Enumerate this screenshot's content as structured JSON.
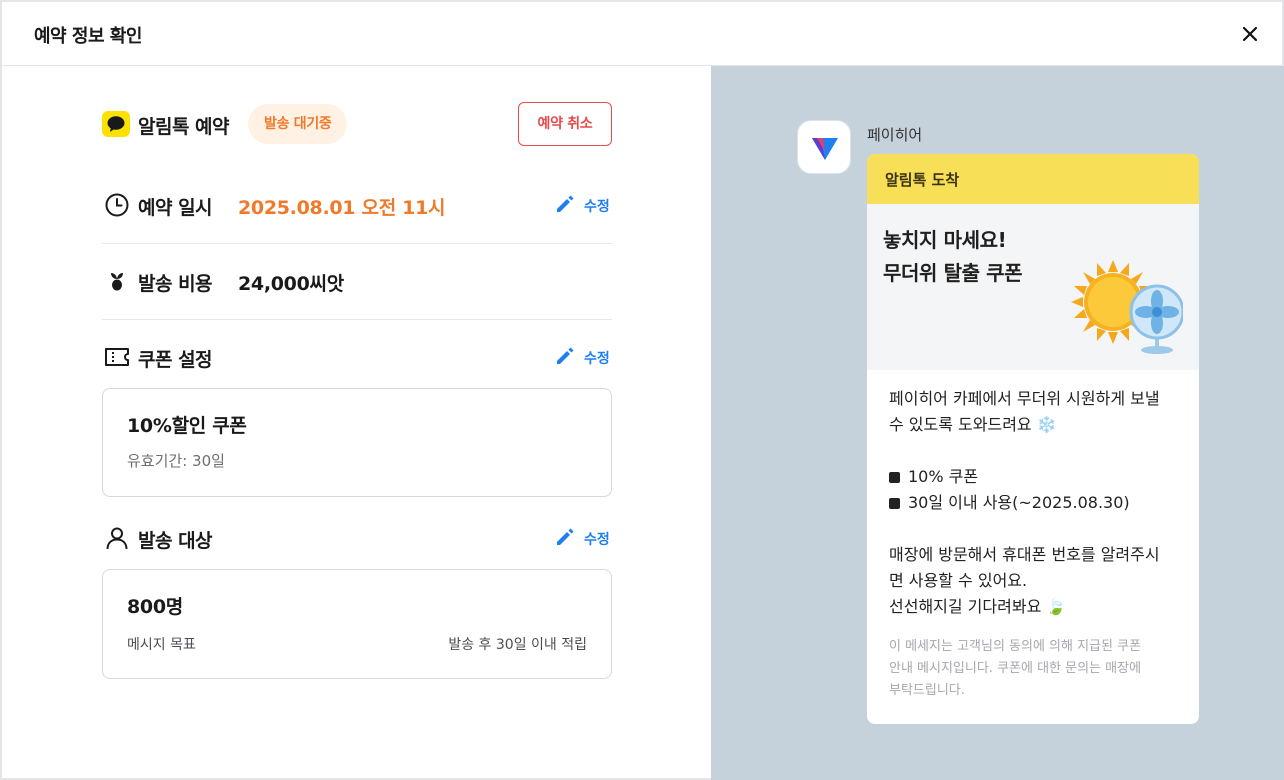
{
  "modal": {
    "title": "예약 정보 확인",
    "close_icon": "close-icon"
  },
  "header": {
    "channel_title": "알림톡 예약",
    "status_badge": "발송 대기중",
    "cancel_label": "예약 취소"
  },
  "schedule": {
    "label": "예약 일시",
    "value": "2025.08.01 오전 11시",
    "edit_label": "수정",
    "value_color": "#f07a2a"
  },
  "cost": {
    "label": "발송 비용",
    "value": "24,000씨앗"
  },
  "coupon": {
    "label": "쿠폰 설정",
    "edit_label": "수정",
    "name": "10%할인 쿠폰",
    "validity": "유효기간: 30일"
  },
  "target": {
    "label": "발송 대상",
    "edit_label": "수정",
    "count": "800명",
    "goal_label": "메시지 목표",
    "goal_value": "발송 후 30일 이내 적립"
  },
  "preview": {
    "sender_name": "페이히어",
    "bubble_header": "알림톡 도착",
    "hero_line1": "놓치지 마세요!",
    "hero_line2": "무더위 탈출 쿠폰",
    "body_line1": "페이히어 카페에서 무더위 시원하게 보낼",
    "body_line2": "수 있도록 도와드려요 ❄️",
    "bullet1": "10% 쿠폰",
    "bullet2": "30일 이내 사용(~2025.08.30)",
    "body_line3": "매장에 방문해서 휴대폰 번호를 알려주시",
    "body_line4": "면 사용할 수 있어요.",
    "body_line5": "선선해지길 기다려봐요 🍃",
    "foot_line1": "이 메세지는 고객님의 동의에 의해 지급된 쿠폰",
    "foot_line2": "안내 메시지입니다.  쿠폰에 대한 문의는 매장에",
    "foot_line3": "부탁드립니다."
  },
  "colors": {
    "accent_blue": "#1d7ff0",
    "danger": "#e94a4a",
    "kakao_yellow": "#fae100",
    "preview_bg": "#c5d2dc"
  }
}
